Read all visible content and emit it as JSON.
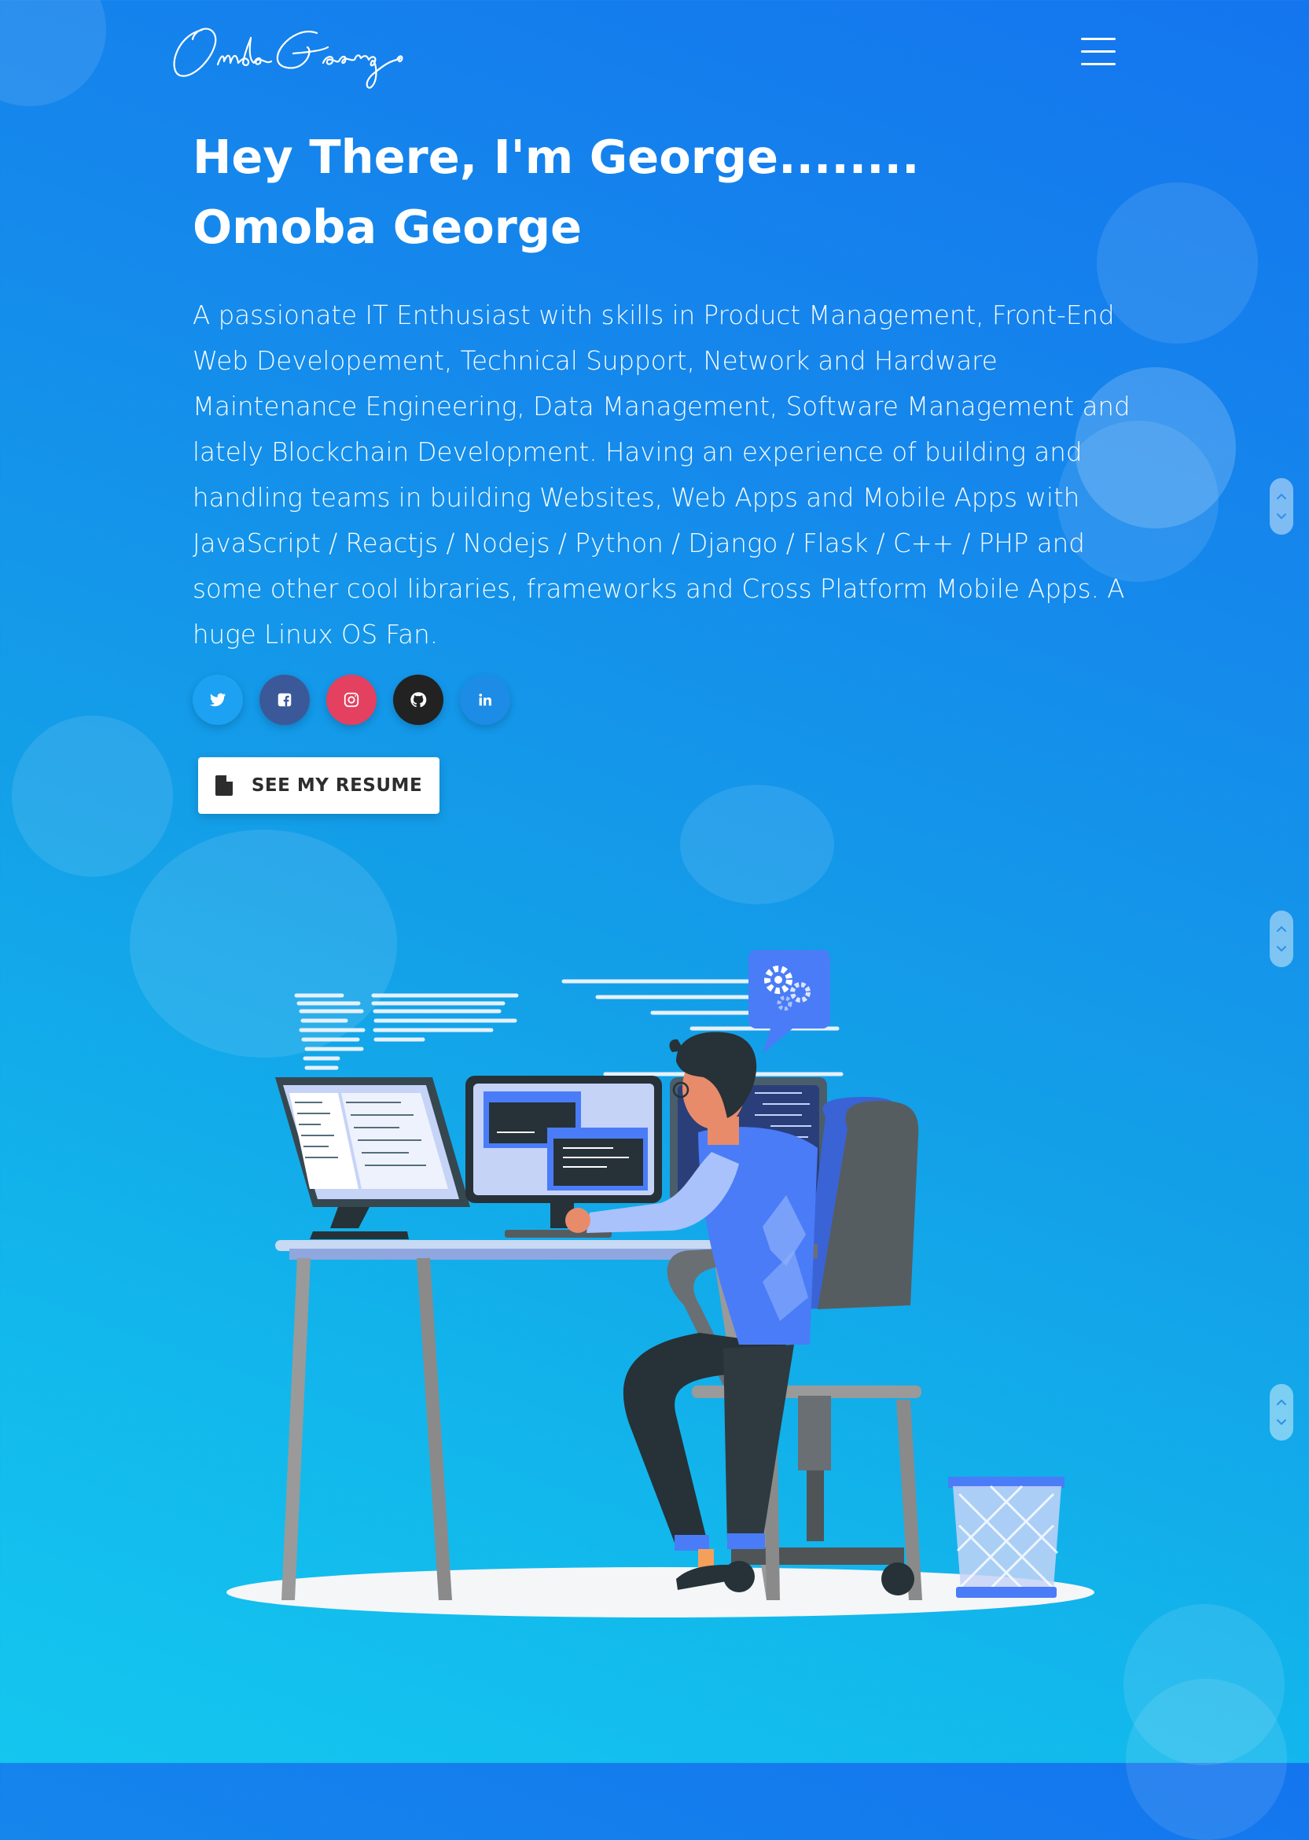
{
  "header": {
    "logo_text": "Omoba George",
    "menu_icon": "hamburger-menu-icon"
  },
  "hero": {
    "headline": "Hey There, I'm George........ Omoba George",
    "bio": "A passionate IT Enthusiast with skills in Product Management, Front-End Web Developement, Technical Support, Network and Hardware Maintenance Engineering, Data Management, Software Management and lately Blockchain Development. Having an experience of building and handling teams in building Websites, Web Apps and Mobile Apps with JavaScript / Reactjs / Nodejs / Python / Django / Flask / C++ / PHP and some other cool libraries, frameworks and Cross Platform Mobile Apps. A huge Linux OS Fan."
  },
  "socials": [
    {
      "name": "twitter",
      "icon": "twitter-icon",
      "color": "#1da1f2"
    },
    {
      "name": "facebook",
      "icon": "facebook-icon",
      "color": "#3b5998"
    },
    {
      "name": "instagram",
      "icon": "instagram-icon",
      "color": "#e4405f"
    },
    {
      "name": "github",
      "icon": "github-icon",
      "color": "#222222"
    },
    {
      "name": "linkedin",
      "icon": "linkedin-icon",
      "color": "#1d8ce6"
    }
  ],
  "resume_button": {
    "label": "SEE MY RESUME",
    "icon": "document-icon"
  },
  "illustration": {
    "subject": "developer working at desk with three monitors"
  },
  "theme": {
    "gradient_start": "#1475ee",
    "gradient_end": "#14c7ef",
    "accent": "#4a7cf7"
  }
}
